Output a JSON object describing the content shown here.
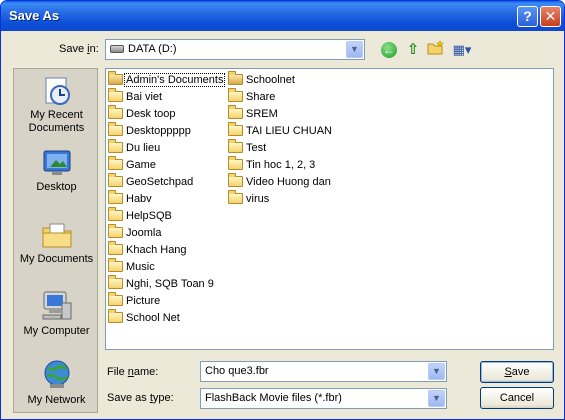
{
  "window": {
    "title": "Save As"
  },
  "titlebar_buttons": {
    "help": "?",
    "close": "✕"
  },
  "save_in": {
    "label_pre": "Save ",
    "label_ul": "i",
    "label_post": "n:",
    "value": "DATA (D:)"
  },
  "toolbar": {
    "back": "←",
    "up": "⇧",
    "views": "▦▾"
  },
  "places": [
    {
      "name": "my-recent-documents",
      "label1": "My Recent",
      "label2": "Documents"
    },
    {
      "name": "desktop",
      "label1": "Desktop",
      "label2": ""
    },
    {
      "name": "my-documents",
      "label1": "My Documents",
      "label2": ""
    },
    {
      "name": "my-computer",
      "label1": "My Computer",
      "label2": ""
    },
    {
      "name": "my-network",
      "label1": "My Network",
      "label2": ""
    }
  ],
  "files_col1": [
    "Admin's Documents",
    "Bai viet",
    "Desk toop",
    "Desktoppppp",
    "Du lieu",
    "Game",
    "GeoSetchpad",
    "Habv",
    "HelpSQB",
    "Joomla",
    "Khach Hang",
    "Music",
    "Nghi, SQB Toan 9",
    "Picture",
    "School Net"
  ],
  "files_col2": [
    "Schoolnet",
    "Share",
    "SREM",
    "TAI LIEU CHUAN",
    "Test",
    "Tin hoc 1, 2, 3",
    "Video Huong dan",
    "virus"
  ],
  "file_name": {
    "label_pre": "File ",
    "label_ul": "n",
    "label_post": "ame:",
    "value": "Cho que3.fbr"
  },
  "save_as_type": {
    "label_pre": "Save as ",
    "label_ul": "t",
    "label_post": "ype:",
    "value": "FlashBack Movie files (*.fbr)"
  },
  "buttons": {
    "save_ul": "S",
    "save_rest": "ave",
    "cancel": "Cancel"
  },
  "colors": {
    "titlebar": "#0b4fd8",
    "panel": "#ece9d8",
    "places_bar": "#d7d3c6",
    "border": "#7f9db9"
  }
}
